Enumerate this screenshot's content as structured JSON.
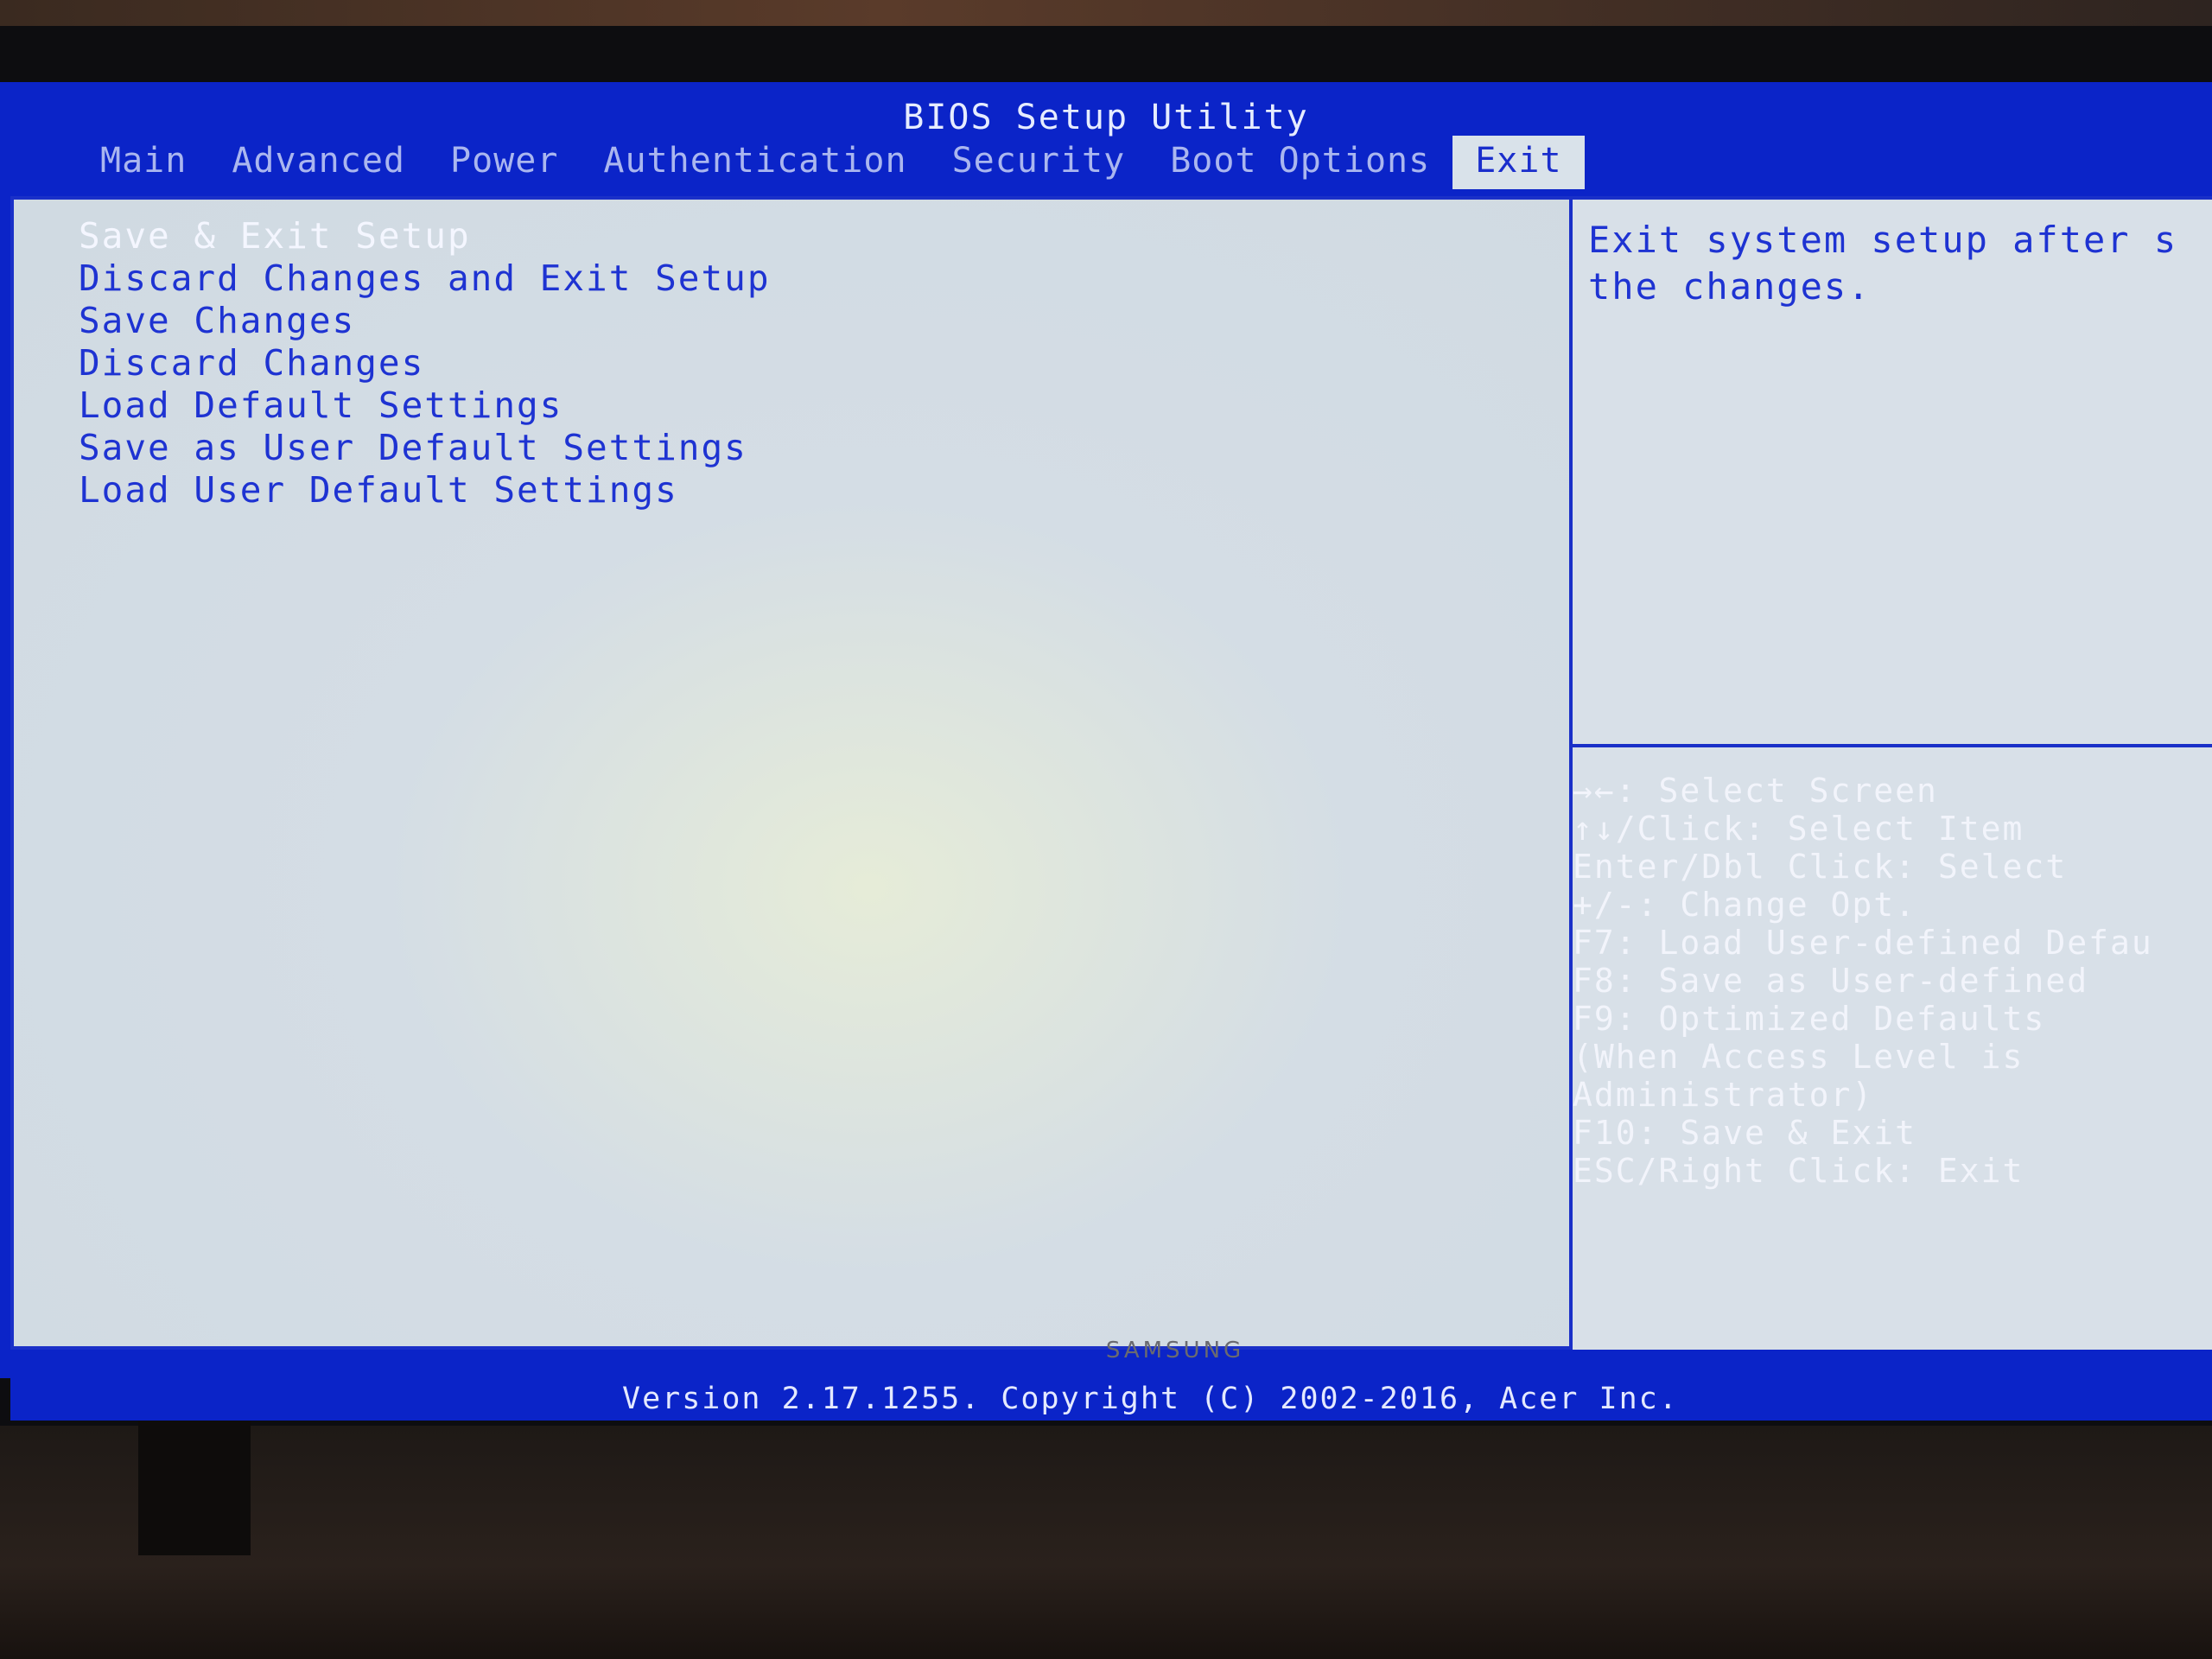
{
  "window": {
    "title": "BIOS Setup Utility"
  },
  "tabs": [
    {
      "label": "Main"
    },
    {
      "label": "Advanced"
    },
    {
      "label": "Power"
    },
    {
      "label": "Authentication"
    },
    {
      "label": "Security"
    },
    {
      "label": "Boot Options"
    },
    {
      "label": "Exit",
      "active": true
    }
  ],
  "menu": {
    "items": [
      {
        "label": "Save & Exit Setup",
        "selected": true
      },
      {
        "label": "Discard Changes and Exit Setup"
      },
      {
        "label": "Save Changes"
      },
      {
        "label": "Discard Changes"
      },
      {
        "label": "Load Default Settings"
      },
      {
        "label": "Save as User Default Settings"
      },
      {
        "label": "Load User Default Settings"
      }
    ]
  },
  "help": {
    "description": "Exit system setup after s the changes."
  },
  "keys": {
    "lines": [
      "→←: Select Screen",
      "↑↓/Click: Select Item",
      "Enter/Dbl Click: Select",
      "+/-: Change Opt.",
      "F7: Load User-defined Defau",
      "F8: Save as User-defined",
      "F9: Optimized Defaults",
      "(When Access Level is",
      "Administrator)",
      "F10: Save & Exit",
      "ESC/Right Click: Exit"
    ]
  },
  "footer": {
    "version": "Version 2.17.1255. Copyright (C) 2002-2016, Acer Inc."
  },
  "monitor": {
    "brand": "SAMSUNG"
  },
  "colors": {
    "bios_blue": "#0b24c8",
    "panel_bg": "#d5dde5",
    "text_blue": "#1e33d2",
    "text_white": "#f2f4fb"
  }
}
